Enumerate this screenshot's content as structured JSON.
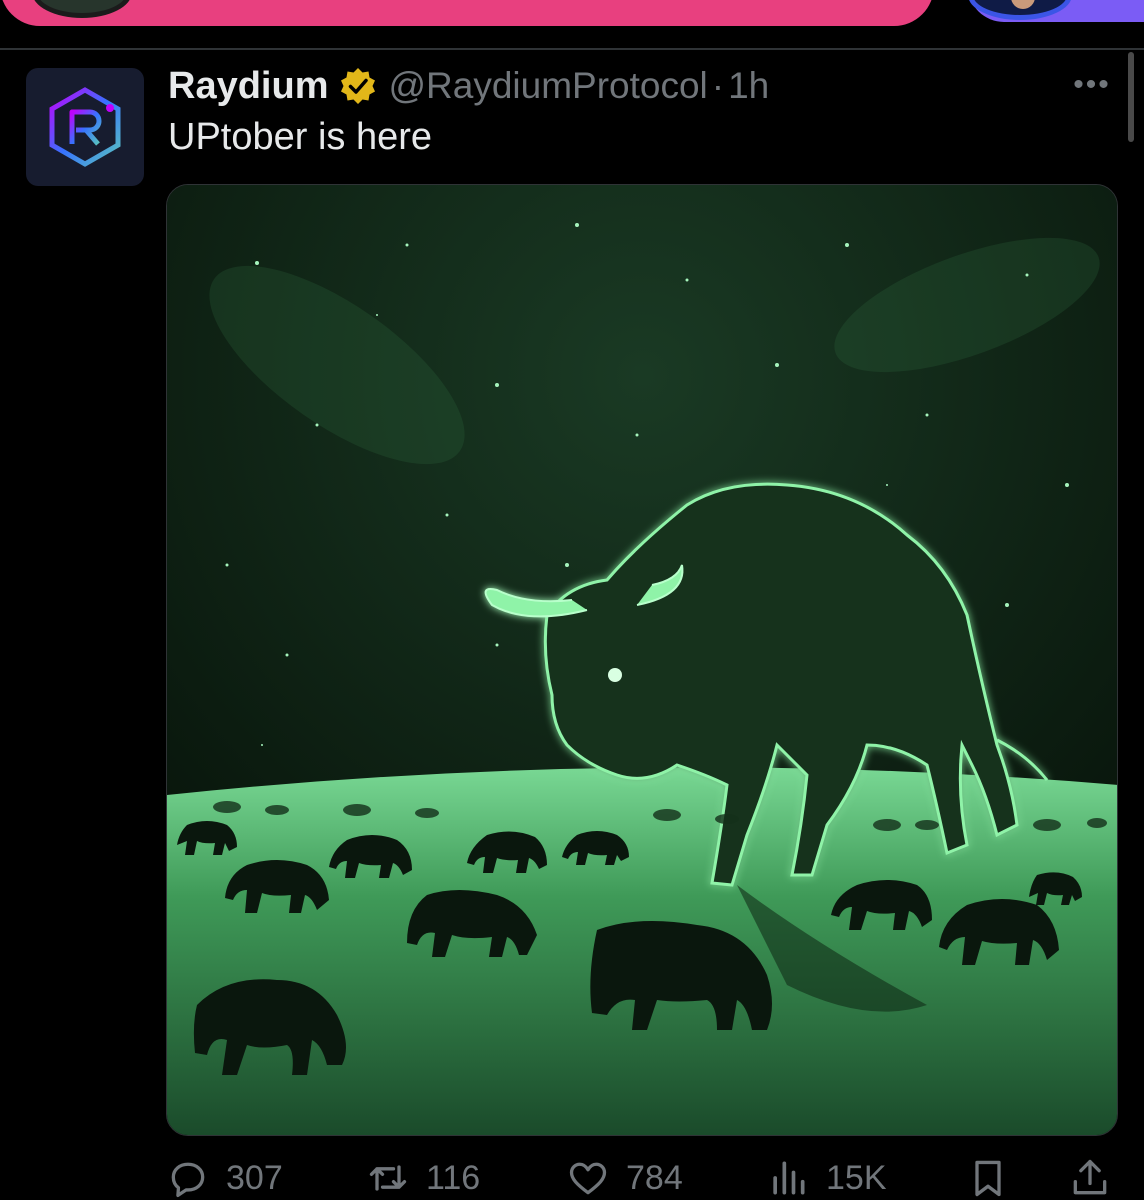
{
  "tweet": {
    "author_name": "Raydium",
    "handle": "@RaydiumProtocol",
    "separator": "·",
    "time": "1h",
    "text": "UPtober is here",
    "more_label": "•••"
  },
  "actions": {
    "replies": "307",
    "retweets": "116",
    "likes": "784",
    "views": "15K"
  },
  "icons": {
    "verified": "verified-badge-icon",
    "reply": "reply-icon",
    "retweet": "retweet-icon",
    "like": "heart-icon",
    "views": "views-chart-icon",
    "bookmark": "bookmark-icon",
    "share": "share-icon"
  },
  "colors": {
    "background": "#000000",
    "text": "#e7e9ea",
    "muted": "#71767b",
    "pink_bar": "#e8407f",
    "purple_bar": "#7b5cf5",
    "verified_gold": "#e2b719",
    "glow_green": "#6fe08a"
  }
}
